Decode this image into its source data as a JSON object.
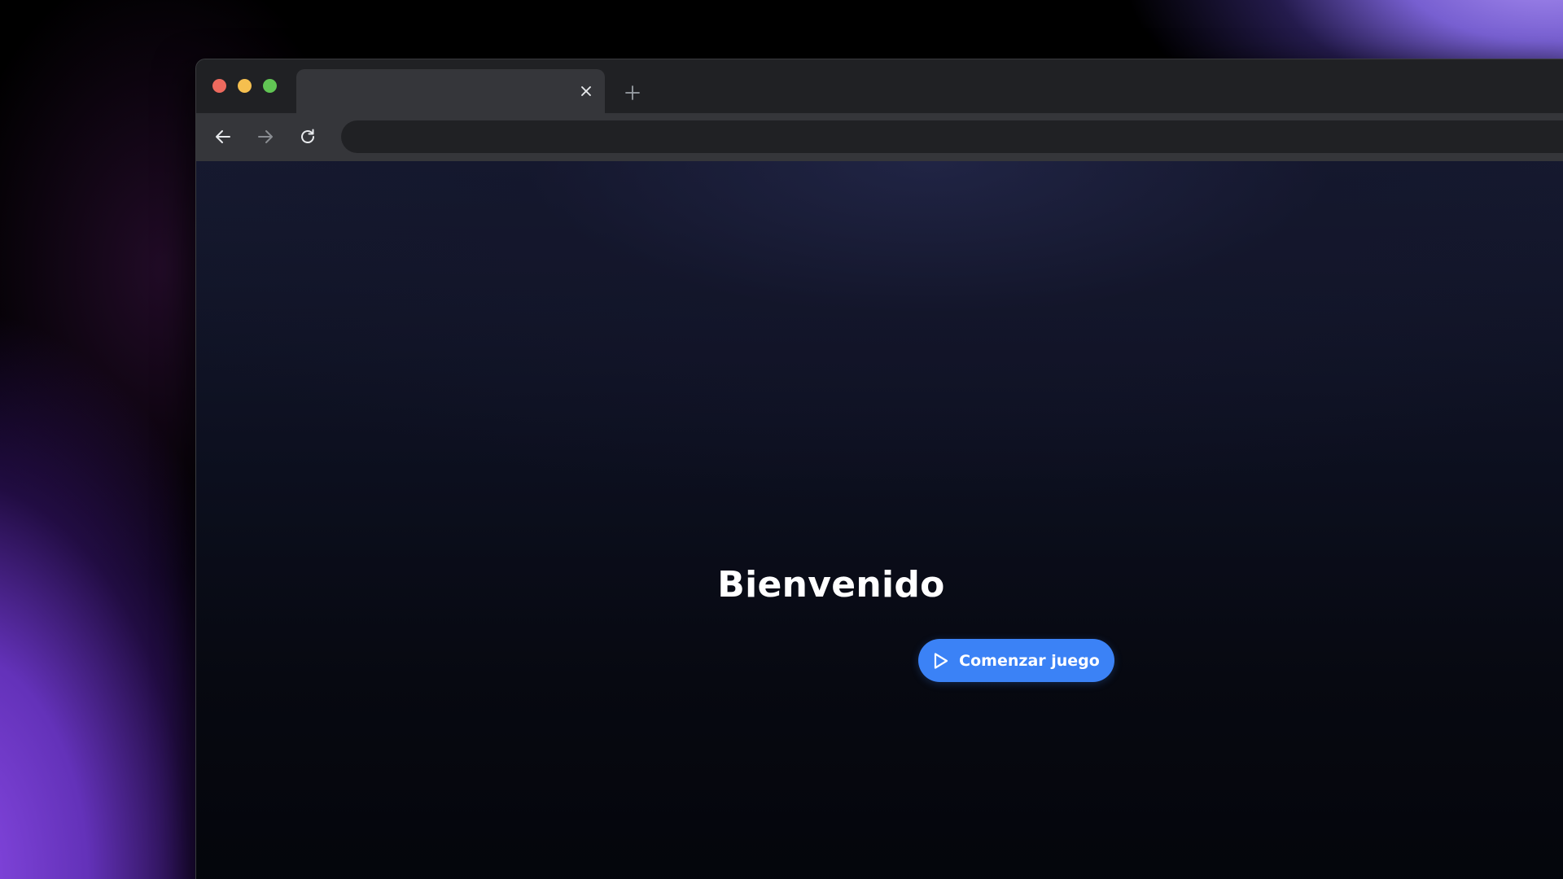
{
  "browser": {
    "tab": {
      "title": "",
      "close_icon": "close-icon"
    },
    "new_tab_icon": "plus-icon",
    "toolbar": {
      "back_icon": "arrow-left-icon",
      "forward_icon": "arrow-right-icon",
      "reload_icon": "reload-icon"
    },
    "address_bar": {
      "value": "",
      "placeholder": ""
    }
  },
  "page": {
    "heading": "Bienvenido",
    "start_button": {
      "label": "Comenzar juego",
      "icon": "play-icon",
      "color": "#3b82f6"
    }
  },
  "colors": {
    "traffic_close": "#ed6a5e",
    "traffic_minimize": "#f5bf4f",
    "traffic_maximize": "#61c554",
    "chrome_dark": "#202124",
    "chrome_tab": "#35363a"
  }
}
